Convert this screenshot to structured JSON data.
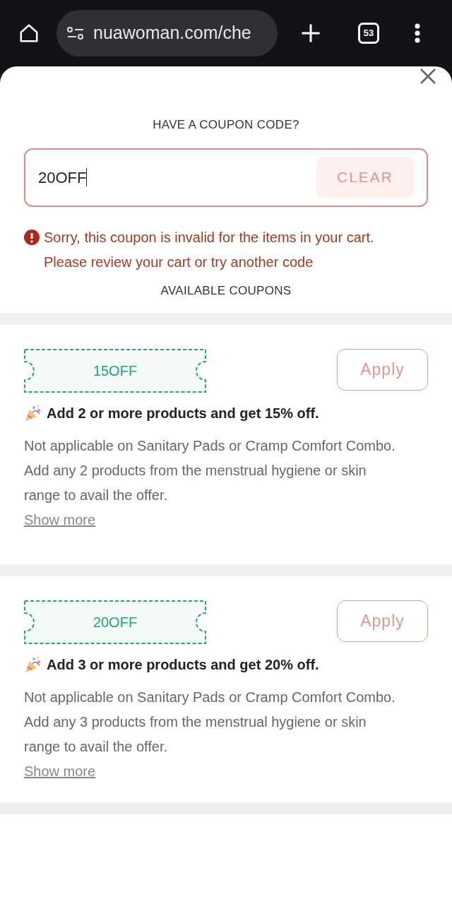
{
  "browser": {
    "url": "nuawoman.com/che",
    "tab_count": "53"
  },
  "heading": "HAVE A COUPON CODE?",
  "coupon_field": {
    "value": "20OFF",
    "clear_label": "CLEAR"
  },
  "error": "Sorry, this coupon is invalid for the items in your cart. Please review your cart or try another code",
  "available_heading": "AVAILABLE COUPONS",
  "coupons": [
    {
      "code": "15OFF",
      "apply_label": "Apply",
      "title": "Add 2 or more products and get 15% off.",
      "description": "Not applicable on Sanitary Pads or Cramp Comfort Combo. Add any 2 products from the menstrual hygiene or skin range to avail the offer.",
      "more_link": "Show more"
    },
    {
      "code": "20OFF",
      "apply_label": "Apply",
      "title": "Add 3 or more products and get 20% off.",
      "description": "Not applicable on Sanitary Pads or Cramp Comfort Combo. Add any 3 products from the menstrual hygiene or skin range to avail the offer.",
      "more_link": "Show more"
    }
  ]
}
